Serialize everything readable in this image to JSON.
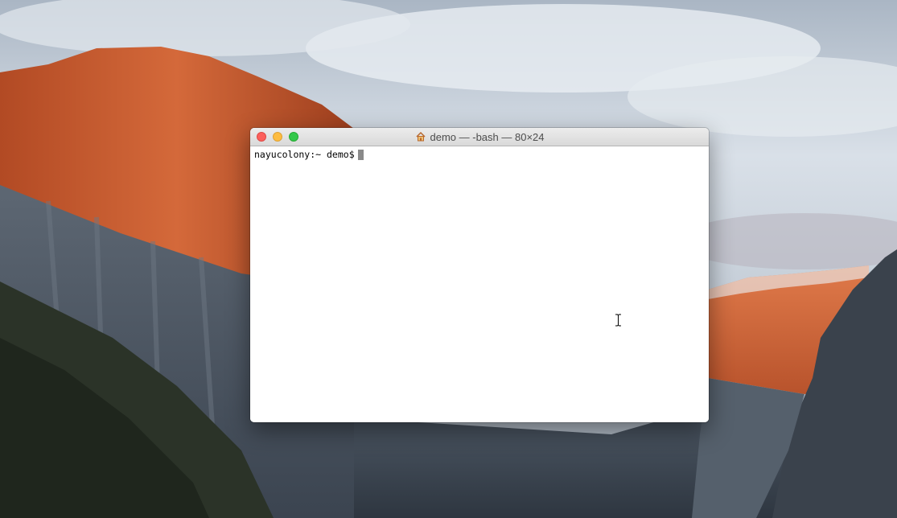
{
  "window": {
    "title": "demo — -bash — 80×24",
    "title_icon": "home-icon",
    "buttons": [
      "close",
      "minimize",
      "zoom"
    ]
  },
  "terminal": {
    "prompt": "nayucolony:~ demo$",
    "background": "#ffffff",
    "text_color": "#000000",
    "cursor_color": "#8a8a8a"
  },
  "colors": {
    "close": "#fc605c",
    "minimize": "#fdbc40",
    "zoom": "#34c84a"
  },
  "pointer": "ibeam-cursor-icon"
}
